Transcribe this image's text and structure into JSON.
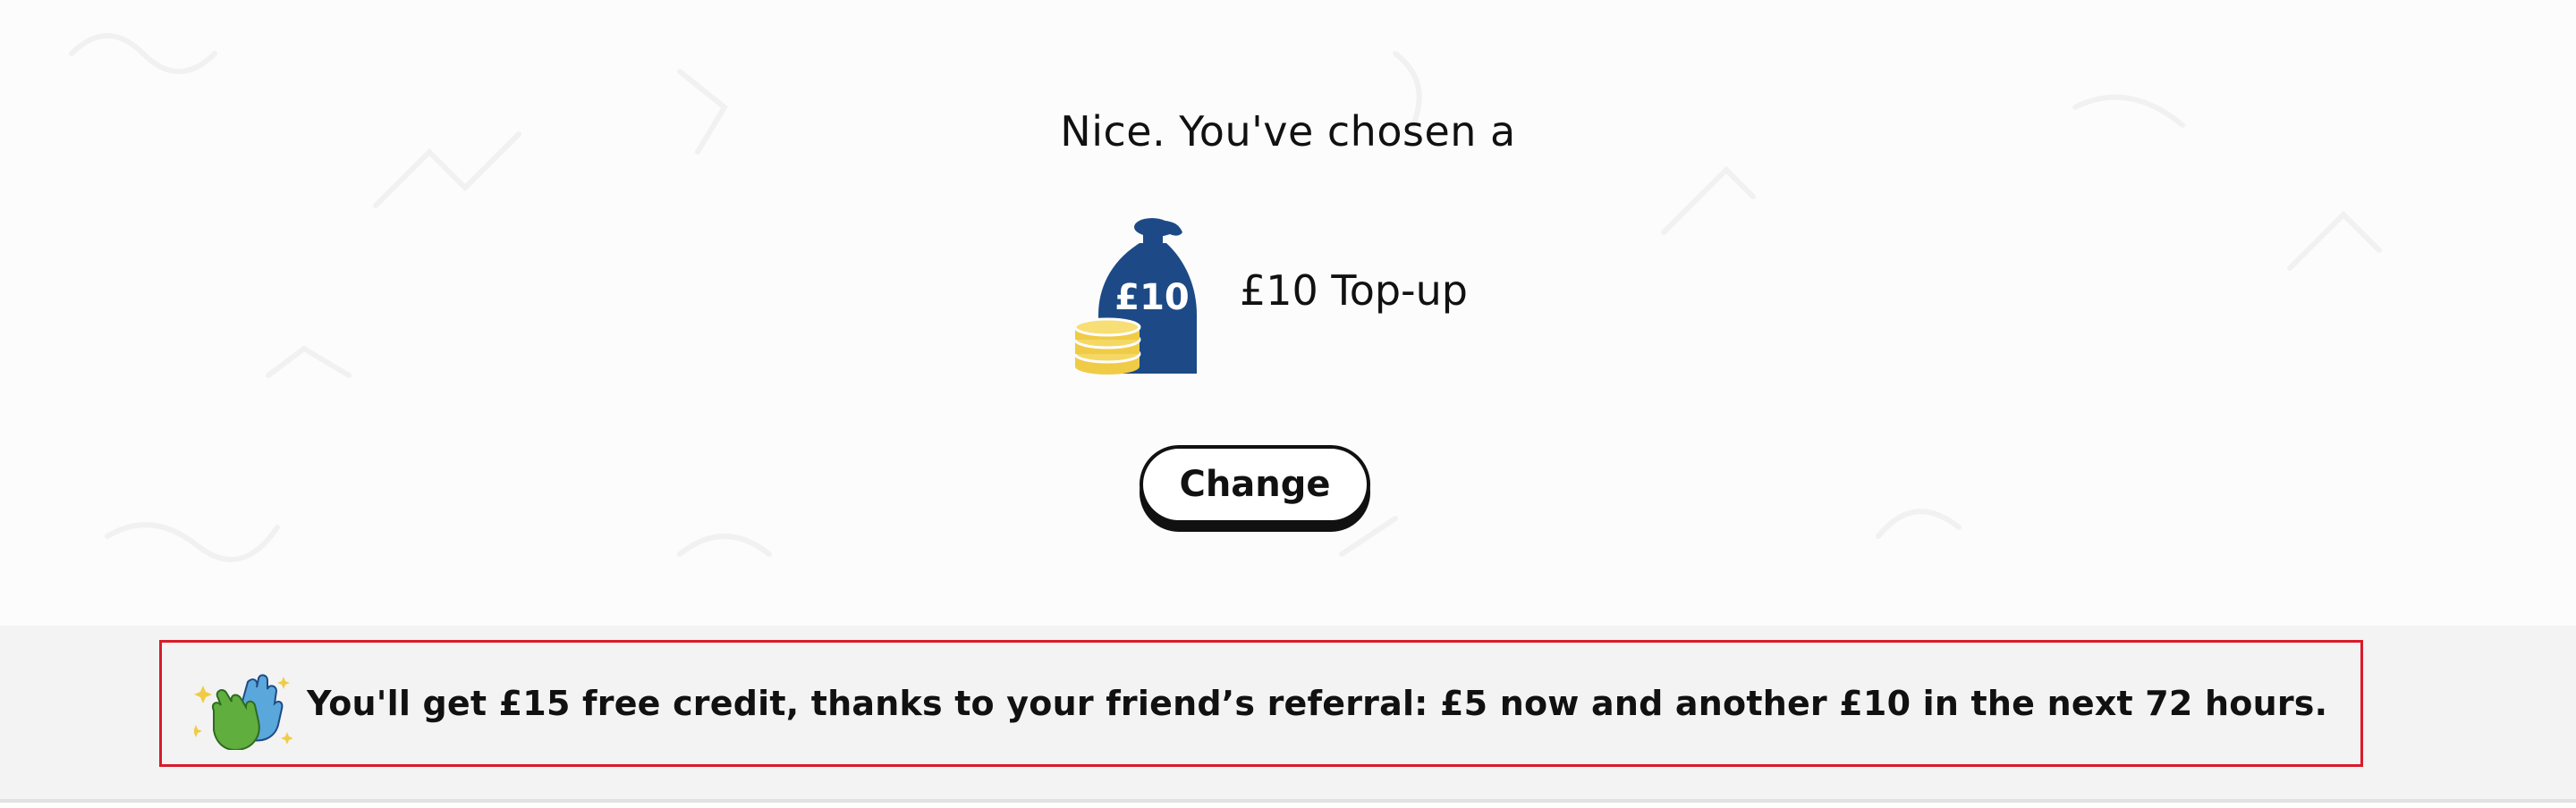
{
  "selection": {
    "heading": "Nice. You've chosen a",
    "bag_label": "£10",
    "product_name": "£10 Top-up",
    "change_label": "Change"
  },
  "referral": {
    "message": "You'll get £15 free credit, thanks to your friend’s referral: £5 now and another £10 in the next 72 hours."
  },
  "colors": {
    "bag": "#1d4a86",
    "coins": "#f0cb45",
    "highlight_border": "#d81b2a",
    "band_background": "#f3f3f3",
    "hand_green": "#5fae3e",
    "hand_blue": "#5aa7dc"
  },
  "icons": {
    "bag": "money-bag-icon",
    "coins": "coin-stack-icon",
    "hands": "high-five-hands-icon"
  }
}
